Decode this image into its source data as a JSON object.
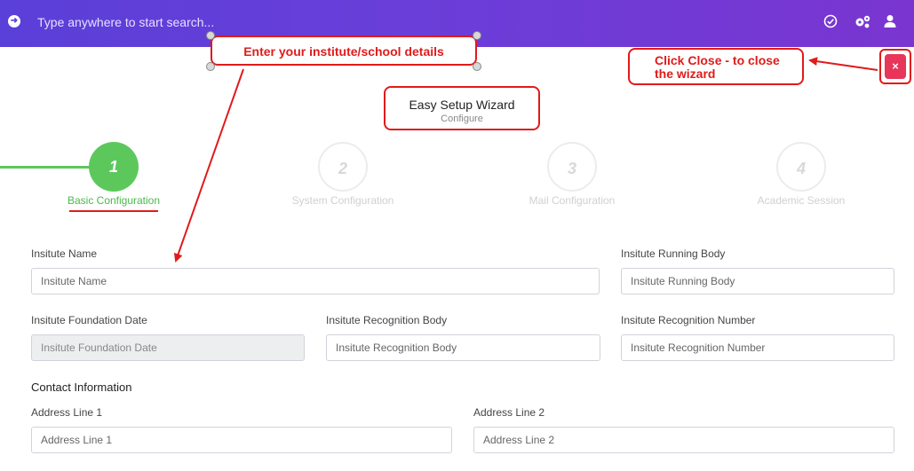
{
  "topbar": {
    "search_placeholder": "Type anywhere to start search...",
    "icons": [
      "arrow-right-circle-icon",
      "check-circle-icon",
      "gears-icon",
      "user-icon"
    ]
  },
  "annotations": {
    "institute_callout": "Enter your institute/school details",
    "close_callout_line1": "Click Close - to close",
    "close_callout_line2": "the wizard",
    "close_button": "×"
  },
  "wizard": {
    "title": "Easy Setup Wizard",
    "subtitle": "Configure",
    "steps": [
      {
        "number": "1",
        "label": "Basic Configuration",
        "active": true
      },
      {
        "number": "2",
        "label": "System Configuration",
        "active": false
      },
      {
        "number": "3",
        "label": "Mail Configuration",
        "active": false
      },
      {
        "number": "4",
        "label": "Academic Session",
        "active": false
      }
    ]
  },
  "form": {
    "institute_name": {
      "label": "Insitute Name",
      "placeholder": "Insitute Name"
    },
    "running_body": {
      "label": "Insitute Running Body",
      "placeholder": "Insitute Running Body"
    },
    "foundation_date": {
      "label": "Insitute Foundation Date",
      "placeholder": "Insitute Foundation Date"
    },
    "recognition_body": {
      "label": "Insitute Recognition Body",
      "placeholder": "Insitute Recognition Body"
    },
    "recognition_number": {
      "label": "Insitute Recognition Number",
      "placeholder": "Insitute Recognition Number"
    },
    "contact_title": "Contact Information",
    "address1": {
      "label": "Address Line 1",
      "placeholder": "Address Line 1"
    },
    "address2": {
      "label": "Address Line 2",
      "placeholder": "Address Line 2"
    }
  },
  "colors": {
    "topbar_start": "#5a3fd8",
    "topbar_end": "#7a35d0",
    "active_step": "#5cc85c",
    "annotation_red": "#e01b1b",
    "close_pink": "#e8355a"
  }
}
